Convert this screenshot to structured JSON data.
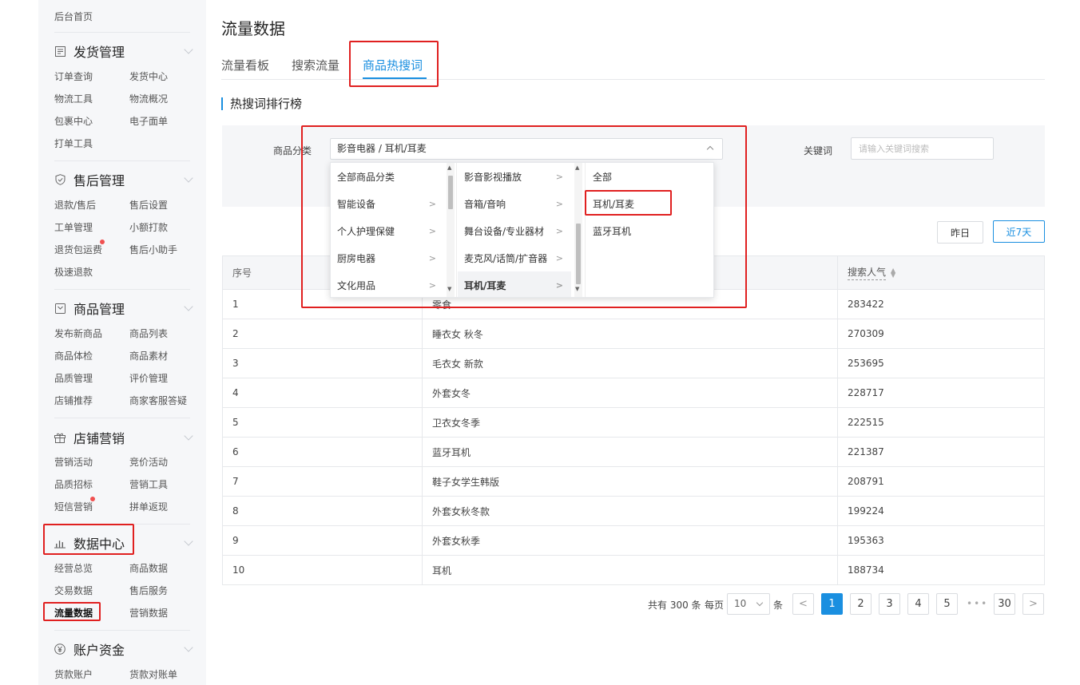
{
  "sidebar": {
    "top_link": "后台首页",
    "sections": [
      {
        "title": "发货管理",
        "icon": "document-list-icon",
        "items": [
          "订单查询",
          "发货中心",
          "物流工具",
          "物流概况",
          "包裹中心",
          "电子面单",
          "打单工具"
        ]
      },
      {
        "title": "售后管理",
        "icon": "shield-check-icon",
        "items": [
          "退款/售后",
          "售后设置",
          "工单管理",
          "小额打款",
          "退货包运费",
          "售后小助手",
          "极速退款"
        ]
      },
      {
        "title": "商品管理",
        "icon": "box-icon",
        "items": [
          "发布新商品",
          "商品列表",
          "商品体检",
          "商品素材",
          "品质管理",
          "评价管理",
          "店铺推荐",
          "商家客服答疑"
        ]
      },
      {
        "title": "店铺营销",
        "icon": "gift-icon",
        "items": [
          "营销活动",
          "竞价活动",
          "品质招标",
          "营销工具",
          "短信营销",
          "拼单返现"
        ]
      },
      {
        "title": "数据中心",
        "icon": "bar-chart-icon",
        "items": [
          "经营总览",
          "商品数据",
          "交易数据",
          "售后服务",
          "流量数据",
          "营销数据"
        ]
      },
      {
        "title": "账户资金",
        "icon": "yen-circle-icon",
        "items": [
          "货款账户",
          "货款对账单"
        ]
      }
    ]
  },
  "page": {
    "title": "流量数据",
    "tabs": [
      "流量看板",
      "搜索流量",
      "商品热搜词"
    ],
    "active_tab": "商品热搜词",
    "section_title": "热搜词排行榜"
  },
  "filters": {
    "category_label": "商品分类",
    "category_value": "影音电器 / 耳机/耳麦",
    "keyword_label": "关键词",
    "keyword_placeholder": "请输入关键词搜索"
  },
  "cascader": {
    "col1": [
      "全部商品分类",
      "智能设备",
      "个人护理保健",
      "厨房电器",
      "文化用品"
    ],
    "col2": [
      "影音影视播放",
      "音箱/音响",
      "舞台设备/专业器材",
      "麦克风/话筒/扩音器",
      "耳机/耳麦"
    ],
    "col3": [
      "全部",
      "耳机/耳麦",
      "蓝牙耳机"
    ]
  },
  "range_buttons": {
    "yesterday": "昨日",
    "last7": "近7天"
  },
  "table": {
    "headers": {
      "rank": "序号",
      "keyword": "",
      "popularity": "搜索人气"
    },
    "rows": [
      {
        "rank": "1",
        "keyword": "零食",
        "popularity": "283422"
      },
      {
        "rank": "2",
        "keyword": "睡衣女 秋冬",
        "popularity": "270309"
      },
      {
        "rank": "3",
        "keyword": "毛衣女 新款",
        "popularity": "253695"
      },
      {
        "rank": "4",
        "keyword": "外套女冬",
        "popularity": "228717"
      },
      {
        "rank": "5",
        "keyword": "卫衣女冬季",
        "popularity": "222515"
      },
      {
        "rank": "6",
        "keyword": "蓝牙耳机",
        "popularity": "221387"
      },
      {
        "rank": "7",
        "keyword": "鞋子女学生韩版",
        "popularity": "208791"
      },
      {
        "rank": "8",
        "keyword": "外套女秋冬款",
        "popularity": "199224"
      },
      {
        "rank": "9",
        "keyword": "外套女秋季",
        "popularity": "195363"
      },
      {
        "rank": "10",
        "keyword": "耳机",
        "popularity": "188734"
      }
    ]
  },
  "pagination": {
    "total_text": "共有 300 条",
    "per_page_label": "每页",
    "per_page_value": "10",
    "unit": "条",
    "pages": [
      "1",
      "2",
      "3",
      "4",
      "5"
    ],
    "last_page": "30",
    "ellipsis": "•••",
    "prev": "<",
    "next": ">"
  },
  "colors": {
    "accent": "#1a8fe0",
    "annotation": "#e02020",
    "badge": "#f05050"
  }
}
